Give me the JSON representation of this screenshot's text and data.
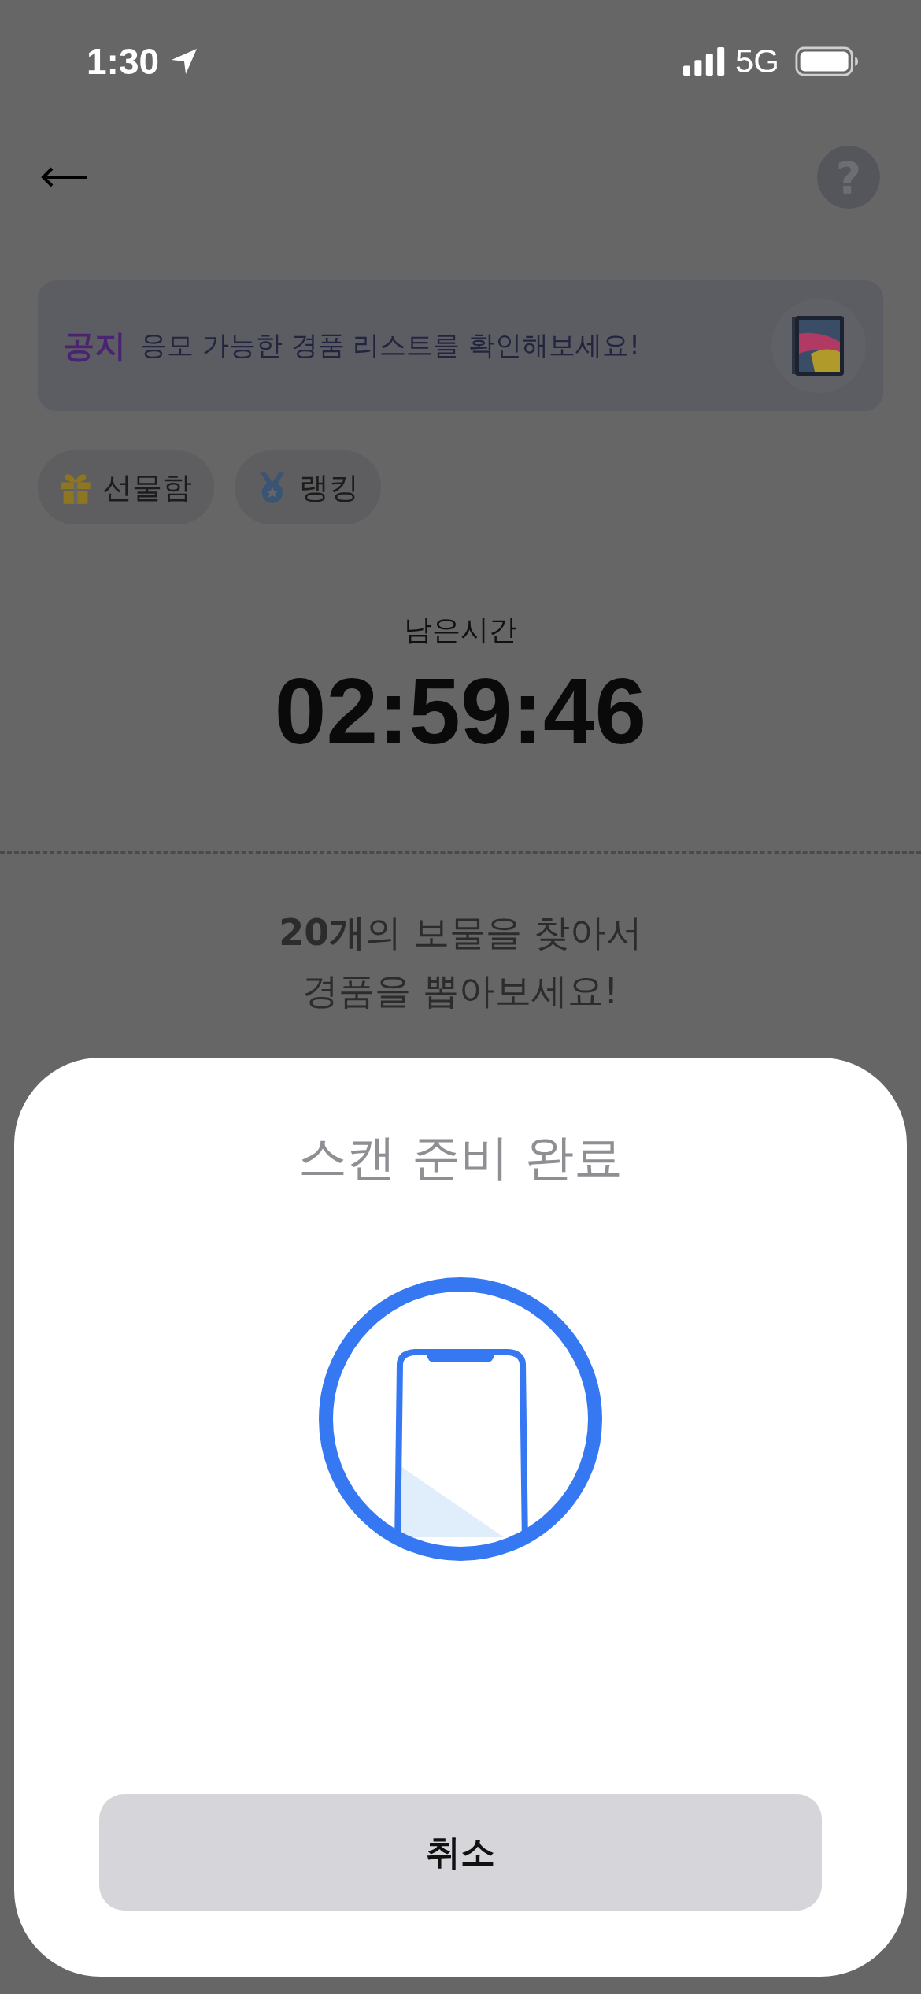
{
  "status_bar": {
    "time": "1:30",
    "network": "5G"
  },
  "header": {
    "help": "?"
  },
  "notice": {
    "label": "공지",
    "text": "응모 가능한 경품 리스트를 확인해보세요!"
  },
  "chips": [
    {
      "kind": "gift",
      "label": "선물함"
    },
    {
      "kind": "medal",
      "label": "랭킹"
    }
  ],
  "timer": {
    "label": "남은시간",
    "value": "02:59:46"
  },
  "mission": {
    "lines": [
      "**20개**의 보물을 찾아서",
      "경품을 뽑아보세요!"
    ]
  },
  "sheet": {
    "title": "스캔 준비 완료",
    "cancel": "취소"
  }
}
